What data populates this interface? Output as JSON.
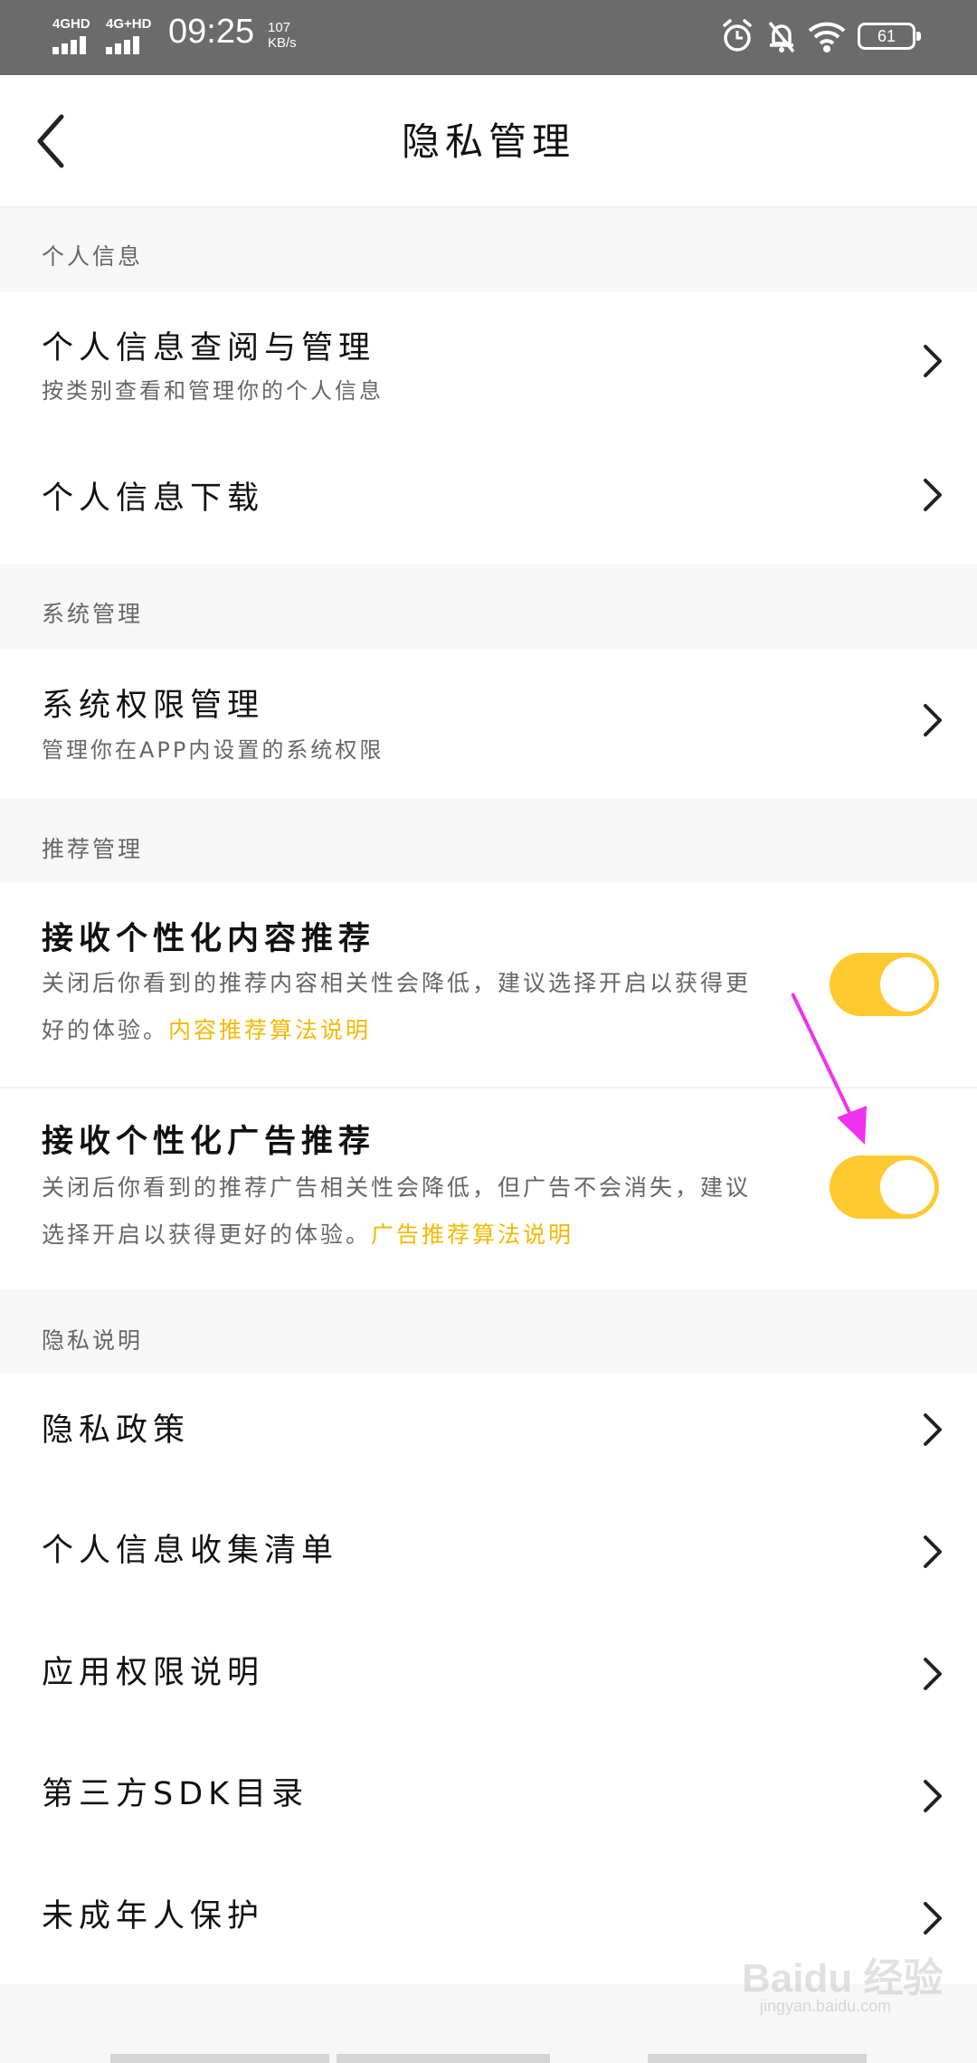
{
  "status_bar": {
    "network_1": "4GHD",
    "network_2": "4G+HD",
    "time": "09:25",
    "speed_value": "107",
    "speed_unit": "KB/s",
    "battery": "61",
    "icons": [
      "alarm-icon",
      "bell-off-icon",
      "wifi-icon",
      "battery-icon"
    ]
  },
  "header": {
    "title": "隐私管理",
    "back_icon": "chevron-left-icon"
  },
  "sections": {
    "personal": {
      "header": "个人信息",
      "items": [
        {
          "title": "个人信息查阅与管理",
          "subtitle": "按类别查看和管理你的个人信息"
        },
        {
          "title": "个人信息下载"
        }
      ]
    },
    "system": {
      "header": "系统管理",
      "items": [
        {
          "title": "系统权限管理",
          "subtitle": "管理你在APP内设置的系统权限"
        }
      ]
    },
    "recommend": {
      "header": "推荐管理",
      "items": [
        {
          "title": "接收个性化内容推荐",
          "desc": "关闭后你看到的推荐内容相关性会降低，建议选择开启以获得更好的体验。",
          "link": "内容推荐算法说明",
          "toggle_on": true
        },
        {
          "title": "接收个性化广告推荐",
          "desc": "关闭后你看到的推荐广告相关性会降低，但广告不会消失，建议选择开启以获得更好的体验。",
          "link": "广告推荐算法说明",
          "toggle_on": true
        }
      ]
    },
    "privacy": {
      "header": "隐私说明",
      "items": [
        {
          "title": "隐私政策"
        },
        {
          "title": "个人信息收集清单"
        },
        {
          "title": "应用权限说明"
        },
        {
          "title": "第三方SDK目录"
        },
        {
          "title": "未成年人保护"
        }
      ]
    }
  },
  "colors": {
    "accent": "#ffc930",
    "link": "#f5b800",
    "annotation_arrow": "#ee33ee",
    "status_bar_bg": "#6b6b6b"
  },
  "watermark": {
    "brand": "Baidu 经验",
    "url": "jingyan.baidu.com"
  }
}
